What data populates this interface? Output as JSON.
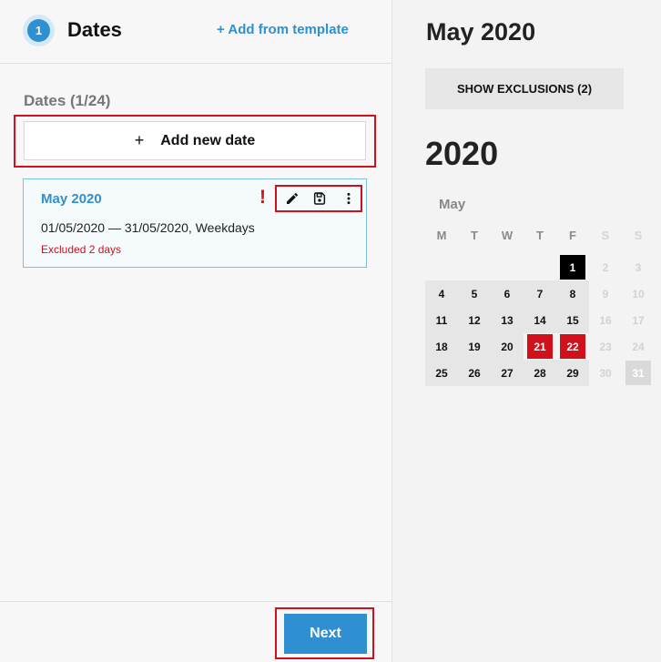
{
  "header": {
    "step_number": "1",
    "title": "Dates",
    "add_template_label": "+ Add from template"
  },
  "dates_section": {
    "count_label": "Dates (1/24)",
    "add_button_plus": "+",
    "add_button_label": "Add new date"
  },
  "date_card": {
    "title": "May 2020",
    "range": "01/05/2020 — 31/05/2020, Weekdays",
    "excluded": "Excluded 2 days",
    "warning": "!"
  },
  "footer": {
    "next_label": "Next"
  },
  "calendar_panel": {
    "month_title": "May 2020",
    "show_exclusions_label": "SHOW EXCLUSIONS (2)",
    "year": "2020",
    "month_name": "May",
    "weekdays": [
      "M",
      "T",
      "W",
      "T",
      "F",
      "S",
      "S"
    ],
    "weeks": [
      [
        "",
        "",
        "",
        "",
        "1",
        "2",
        "3"
      ],
      [
        "4",
        "5",
        "6",
        "7",
        "8",
        "9",
        "10"
      ],
      [
        "11",
        "12",
        "13",
        "14",
        "15",
        "16",
        "17"
      ],
      [
        "18",
        "19",
        "20",
        "21",
        "22",
        "23",
        "24"
      ],
      [
        "25",
        "26",
        "27",
        "28",
        "29",
        "30",
        "31"
      ]
    ],
    "selected_day": "1",
    "excluded_days": [
      "21",
      "22"
    ],
    "highlighted_day": "31"
  },
  "colors": {
    "accent": "#2f8fd0",
    "danger": "#d0101a"
  },
  "icons": [
    "pencil-icon",
    "save-icon",
    "more-vertical-icon",
    "warning-icon"
  ]
}
